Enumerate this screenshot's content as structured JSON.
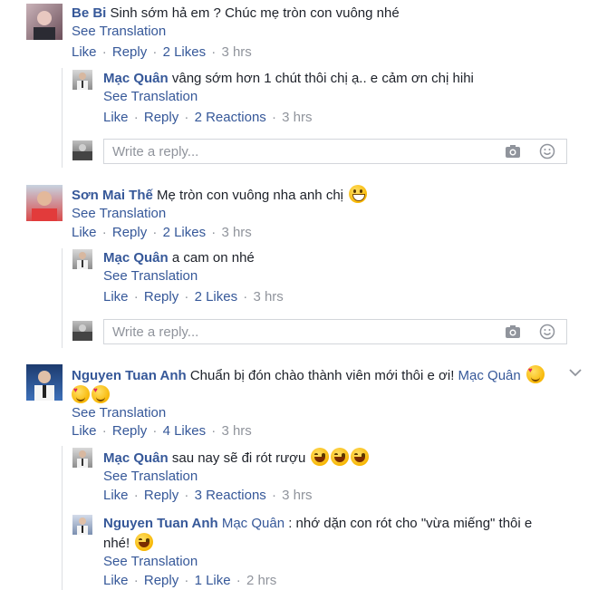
{
  "comments": [
    {
      "author": "Be Bi",
      "text": "Sinh sớm hả em ? Chúc mẹ tròn con vuông nhé",
      "see_translation": "See Translation",
      "like": "Like",
      "reply": "Reply",
      "reactions": "2 Likes",
      "time": "3 hrs",
      "replies": [
        {
          "author": "Mạc Quân",
          "text": "vâng sớm hơn 1 chút thôi chị ạ.. e cảm ơn chị hihi",
          "see_translation": "See Translation",
          "like": "Like",
          "reply": "Reply",
          "reactions": "2 Reactions",
          "time": "3 hrs"
        }
      ],
      "reply_placeholder": "Write a reply..."
    },
    {
      "author": "Sơn Mai Thế",
      "text": "Mẹ tròn con vuông nha anh chị",
      "see_translation": "See Translation",
      "like": "Like",
      "reply": "Reply",
      "reactions": "2 Likes",
      "time": "3 hrs",
      "replies": [
        {
          "author": "Mạc Quân",
          "text": "a cam on nhé",
          "see_translation": "See Translation",
          "like": "Like",
          "reply": "Reply",
          "reactions": "2 Likes",
          "time": "3 hrs"
        }
      ],
      "reply_placeholder": "Write a reply..."
    },
    {
      "author": "Nguyen Tuan Anh",
      "text": "Chuẩn bị đón chào thành viên mới thôi e ơi!",
      "mention": "Mạc Quân",
      "see_translation": "See Translation",
      "like": "Like",
      "reply": "Reply",
      "reactions": "4 Likes",
      "time": "3 hrs",
      "replies": [
        {
          "author": "Mạc Quân",
          "text": "sau nay sẽ đi rót rượu",
          "see_translation": "See Translation",
          "like": "Like",
          "reply": "Reply",
          "reactions": "3 Reactions",
          "time": "3 hrs"
        },
        {
          "author": "Nguyen Tuan Anh",
          "mention": "Mạc Quân",
          "text_line1": ": nhớ dặn con rót cho \"vừa miếng\" thôi e",
          "text_line2": "nhé!",
          "see_translation": "See Translation",
          "like": "Like",
          "reply": "Reply",
          "reactions": "1 Like",
          "time": "2 hrs"
        }
      ]
    }
  ],
  "sep": "·",
  "icons": {
    "camera": "camera-icon",
    "sticker": "smiley-icon",
    "more": "chevron-down-icon"
  },
  "colors": {
    "link": "#365899",
    "meta": "#90949c",
    "border": "#dddfe2"
  }
}
